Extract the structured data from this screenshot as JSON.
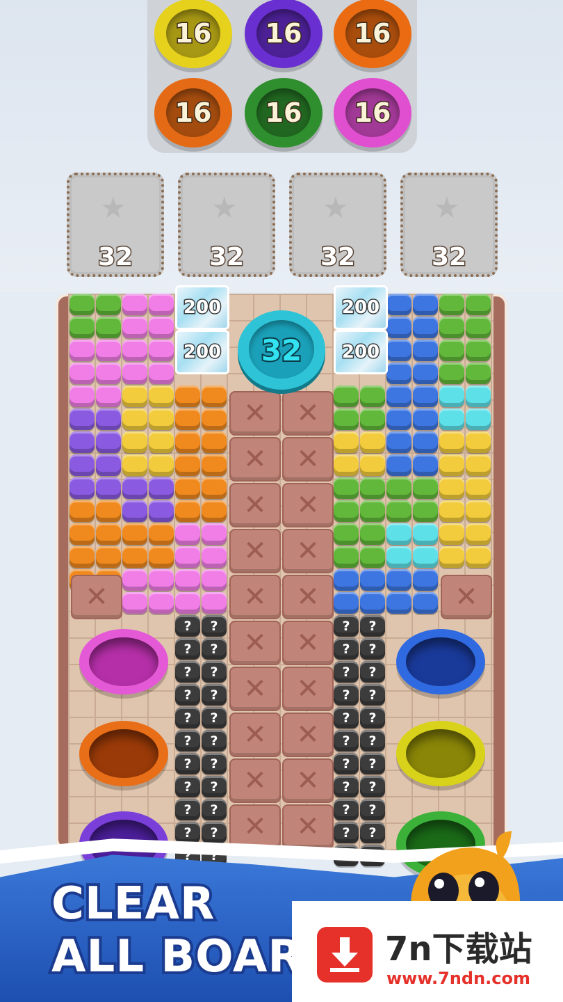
{
  "rings": {
    "items": [
      {
        "label": "16",
        "color": "#e6d21c"
      },
      {
        "label": "16",
        "color": "#6a2fd0"
      },
      {
        "label": "16",
        "color": "#ea6b12"
      },
      {
        "label": "16",
        "color": "#e46a16"
      },
      {
        "label": "16",
        "color": "#2f8f2e"
      },
      {
        "label": "16",
        "color": "#e04fd0"
      }
    ]
  },
  "slots": [
    {
      "label": "32"
    },
    {
      "label": "32"
    },
    {
      "label": "32"
    },
    {
      "label": "32"
    }
  ],
  "board": {
    "goal_label": "32",
    "cube_labels": [
      "200",
      "200",
      "200",
      "200"
    ],
    "hidden_block_label": "?",
    "blocked_tile_label": "✕",
    "holes_left": [
      "#e45ad6",
      "#e86e18",
      "#7a3fd8"
    ],
    "holes_right": [
      "#2f6ae0",
      "#d8d21a",
      "#3bb13a"
    ]
  },
  "promo": {
    "line1": "CLEAR",
    "line2": "ALL BOARD"
  },
  "watermark": {
    "title": "7n下载站",
    "url": "www.7ndn.com"
  },
  "colors": {
    "green": "#62b83a",
    "pink": "#f07ee6",
    "blue": "#3d76e0",
    "purple": "#8a5ae0",
    "yellow": "#f2cc3c",
    "orange": "#f08a1e",
    "cyan": "#5ee0e8",
    "dark": "#3c3c3c"
  }
}
